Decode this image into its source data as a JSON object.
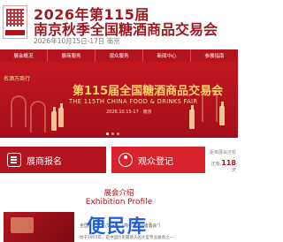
{
  "header": {
    "title_line1": "2026年第115届",
    "title_line2": "南京秋季全国糖酒商品交易会",
    "date_line": "2026年10月15日-17日  南京"
  },
  "nav": {
    "items": [
      "展会概况",
      "展商服务",
      "观众服务",
      "新闻中心",
      "参展指南"
    ]
  },
  "banner": {
    "left_text": "名酒万商行",
    "cn_title": "第115届全国糖酒商品交易会",
    "en_title": "THE 115TH CHINA FOOD & DRINKS FAIR",
    "meta": "2026.10.15-17 · 南京"
  },
  "actions": {
    "exhibitor_label": "展商报名",
    "visitor_label": "观众登记",
    "countdown_label": "距离展会还有",
    "countdown_prefix": "还有",
    "countdown_value": "118",
    "countdown_unit": "天"
  },
  "profile": {
    "section_title": "展会介绍",
    "section_subtitle": "Exhibition Profile",
    "desc_line1": "全国糖酒商品交易会（简称\"全国糖酒会\"）",
    "desc_line2": "始于1955年，是中国历史最悠久的大型专业展会之一"
  },
  "watermark": "便民库"
}
